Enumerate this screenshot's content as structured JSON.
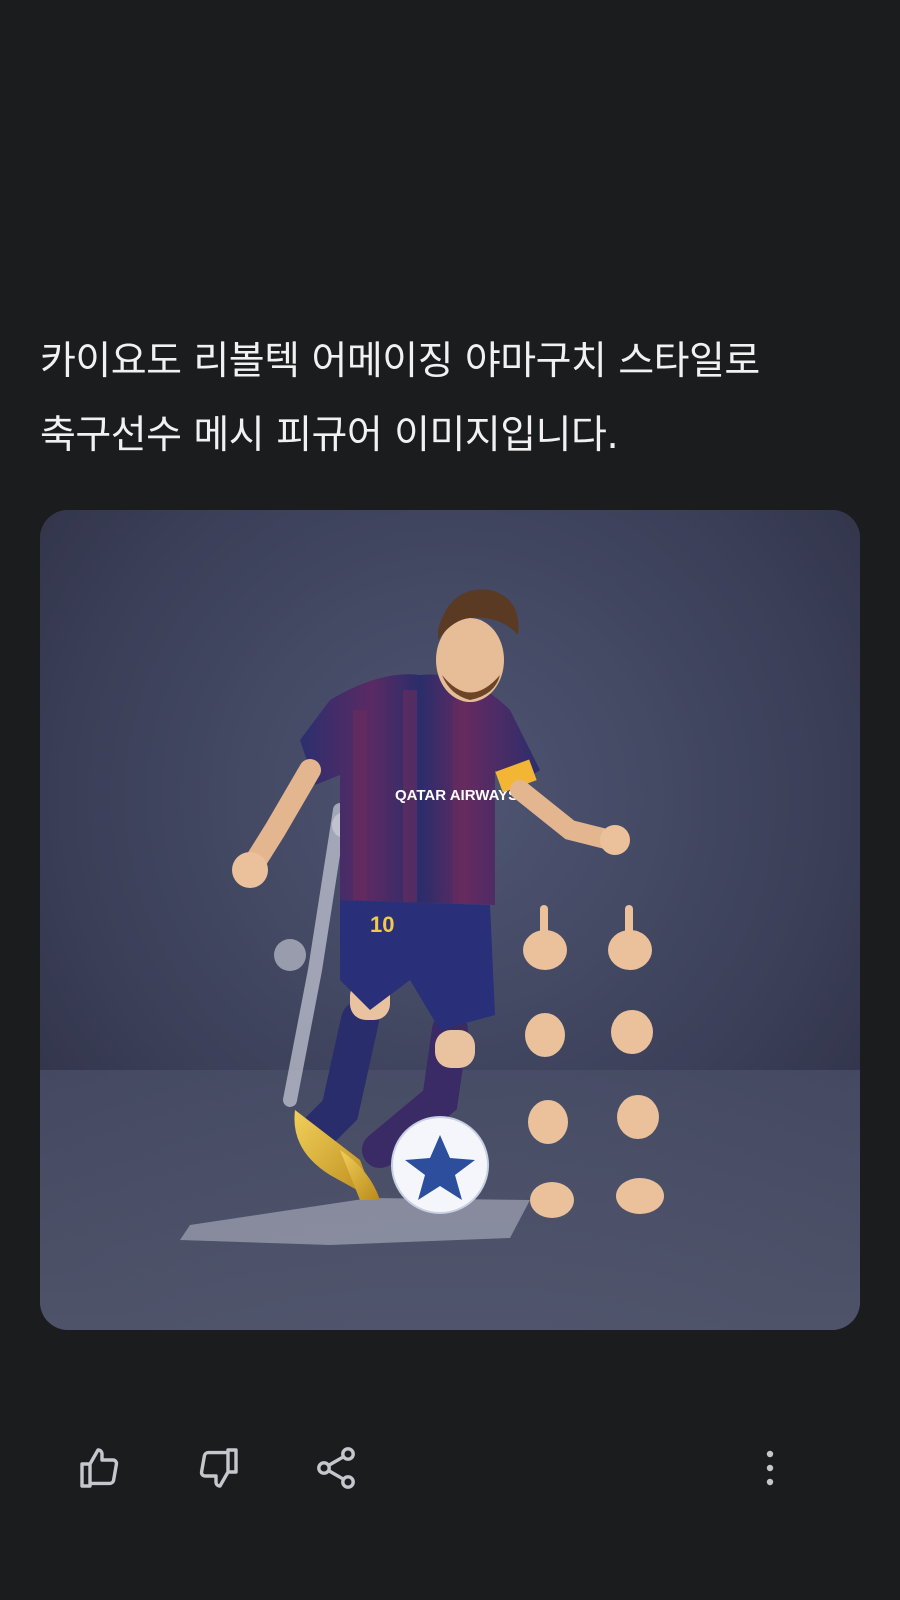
{
  "message": {
    "text_line1": "카이요도 리볼텍 어메이징 야마구치 스타일로",
    "text_line2": "축구선수 메시 피규어 이미지입니다."
  },
  "image": {
    "jersey_sponsor": "QATAR AIRWAYS",
    "jersey_number": "10"
  },
  "actions": {
    "like_icon": "thumbs-up-icon",
    "dislike_icon": "thumbs-down-icon",
    "share_icon": "share-icon",
    "more_icon": "more-vertical-icon"
  },
  "colors": {
    "background": "#1b1c1e",
    "text": "#f1f1f1",
    "icon": "#c4c7cc"
  }
}
